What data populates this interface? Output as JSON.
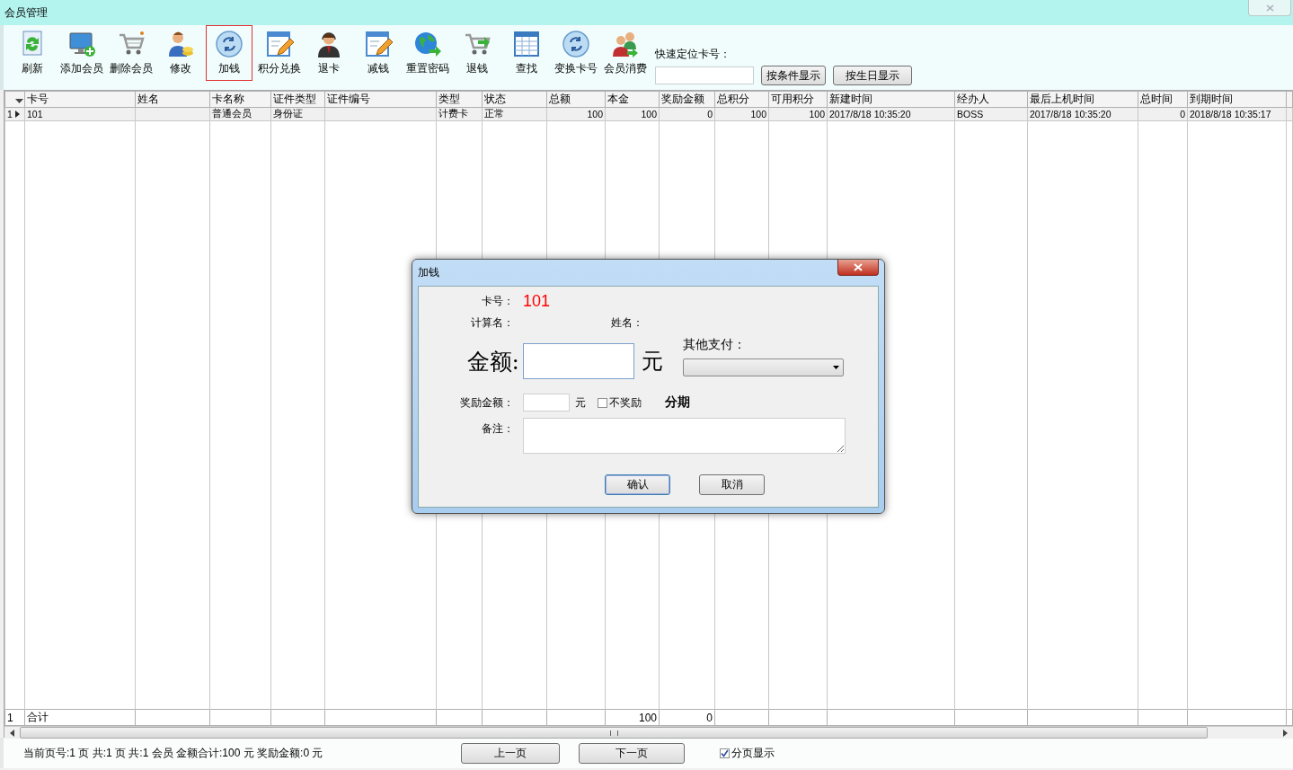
{
  "window": {
    "title": "会员管理"
  },
  "toolbar": {
    "buttons": [
      {
        "label": "刷新",
        "selected": false
      },
      {
        "label": "添加会员",
        "selected": false
      },
      {
        "label": "删除会员",
        "selected": false
      },
      {
        "label": "修改",
        "selected": false
      },
      {
        "label": "加钱",
        "selected": true
      },
      {
        "label": "积分兑换",
        "selected": false
      },
      {
        "label": "退卡",
        "selected": false
      },
      {
        "label": "减钱",
        "selected": false
      },
      {
        "label": "重置密码",
        "selected": false
      },
      {
        "label": "退钱",
        "selected": false
      },
      {
        "label": "查找",
        "selected": false
      },
      {
        "label": "变换卡号",
        "selected": false
      },
      {
        "label": "会员消费",
        "selected": false
      }
    ]
  },
  "quick_locate": {
    "label": "快速定位卡号：",
    "buttons": [
      "按条件显示",
      "按生日显示"
    ]
  },
  "table": {
    "columns": [
      {
        "name": "卡号"
      },
      {
        "name": "姓名"
      },
      {
        "name": "卡名称"
      },
      {
        "name": "证件类型"
      },
      {
        "name": "证件编号"
      },
      {
        "name": "类型"
      },
      {
        "name": "状态"
      },
      {
        "name": "总额"
      },
      {
        "name": "本金"
      },
      {
        "name": "奖励金额"
      },
      {
        "name": "总积分"
      },
      {
        "name": "可用积分"
      },
      {
        "name": "新建时间"
      },
      {
        "name": "经办人"
      },
      {
        "name": "最后上机时间"
      },
      {
        "name": "总时间"
      },
      {
        "name": "到期时间"
      }
    ],
    "rows": [
      {
        "number": "1",
        "current": true,
        "cells": [
          "101",
          "",
          "普通会员",
          "身份证",
          "",
          "计费卡",
          "正常",
          "100",
          "100",
          "0",
          "100",
          "100",
          "2017/8/18 10:35:20",
          "BOSS",
          "2017/8/18 10:35:20",
          "0",
          "2018/8/18 10:35:17"
        ]
      }
    ],
    "footer": {
      "number": "1",
      "cells": [
        "合计",
        "",
        "",
        "",
        "",
        "",
        "",
        "",
        "100",
        "0",
        "",
        "",
        "",
        "",
        "",
        "",
        ""
      ]
    }
  },
  "status_bar": {
    "summary": "当前页号:1 页 共:1 页 共:1 会员 金额合计:100 元 奖励金额:0 元",
    "prev": "上一页",
    "next": "下一页",
    "paging": {
      "label": "分页显示",
      "checked": true
    }
  },
  "dialog": {
    "title": "加钱",
    "card_label": "卡号：",
    "card_value": "101",
    "calc_label": "计算名：",
    "name_label": "姓名：",
    "amount_label": "金额:",
    "amount_unit": "元",
    "other_pay_label": "其他支付：",
    "bonus_label": "奖励金额：",
    "bonus_unit": "元",
    "no_bonus": {
      "label": "不奖励",
      "checked": false
    },
    "installment": "分期",
    "note_label": "备注：",
    "ok": "确认",
    "cancel": "取消"
  }
}
